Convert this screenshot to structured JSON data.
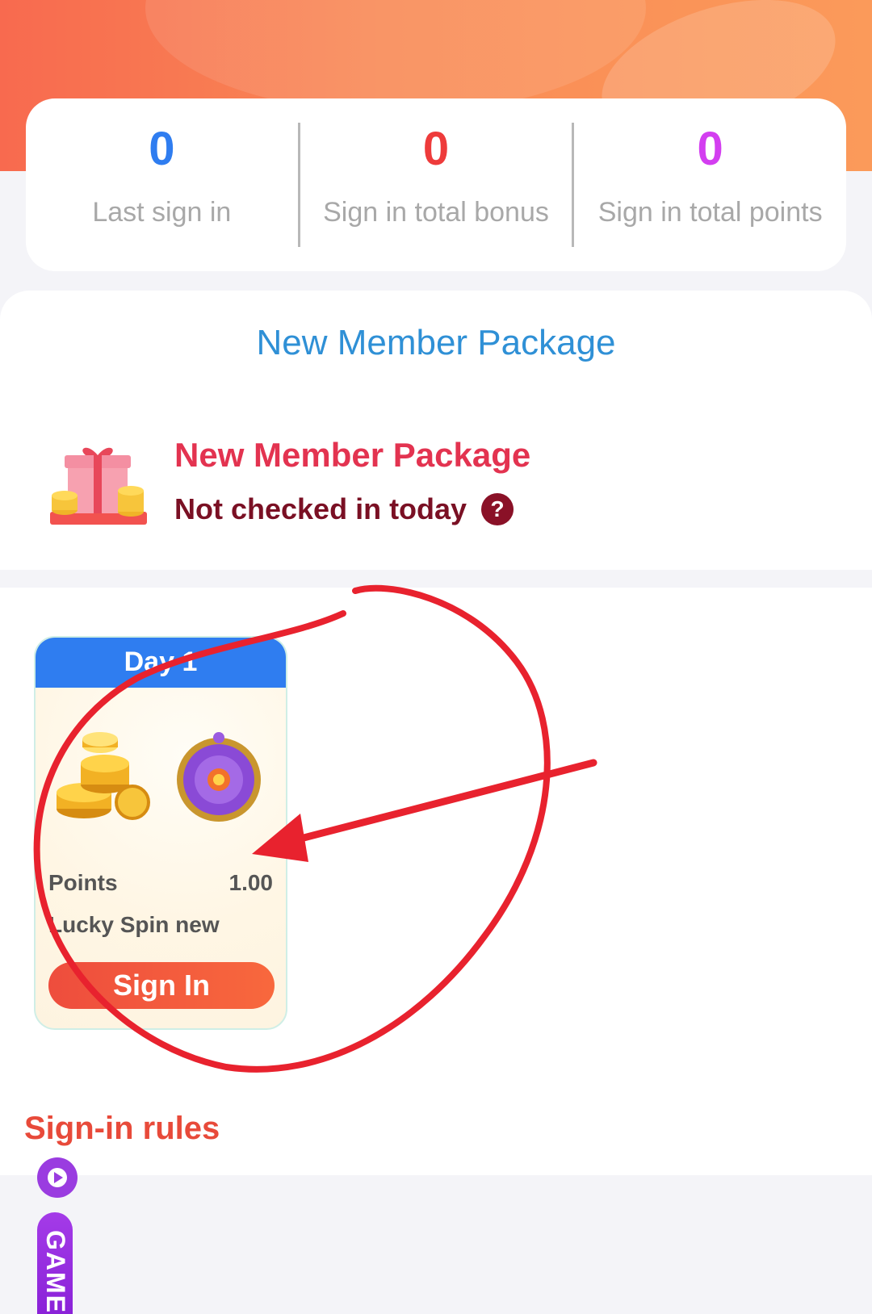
{
  "stats": [
    {
      "value": "0",
      "label": "Last sign in",
      "color": "#2f7df0"
    },
    {
      "value": "0",
      "label": "Sign in total bonus",
      "color": "#ee3b3b"
    },
    {
      "value": "0",
      "label": "Sign in total points",
      "color": "#d33ef0"
    }
  ],
  "package": {
    "section_title": "New Member Package",
    "name": "New Member Package",
    "status": "Not checked in today",
    "help_icon": "?"
  },
  "day_card": {
    "header": "Day 1",
    "reward_label": "Points",
    "reward_value": "1.00",
    "reward_item": "Lucky Spin new",
    "button_label": "Sign In"
  },
  "rules": {
    "title": "Sign-in rules"
  },
  "floating": {
    "game_label": "GAME",
    "play_icon": "play-icon"
  },
  "colors": {
    "header_gradient_start": "#f86a4f",
    "header_gradient_end": "#fb9a5a",
    "annotation": "#e8222e",
    "accent_blue": "#2f7df0"
  }
}
